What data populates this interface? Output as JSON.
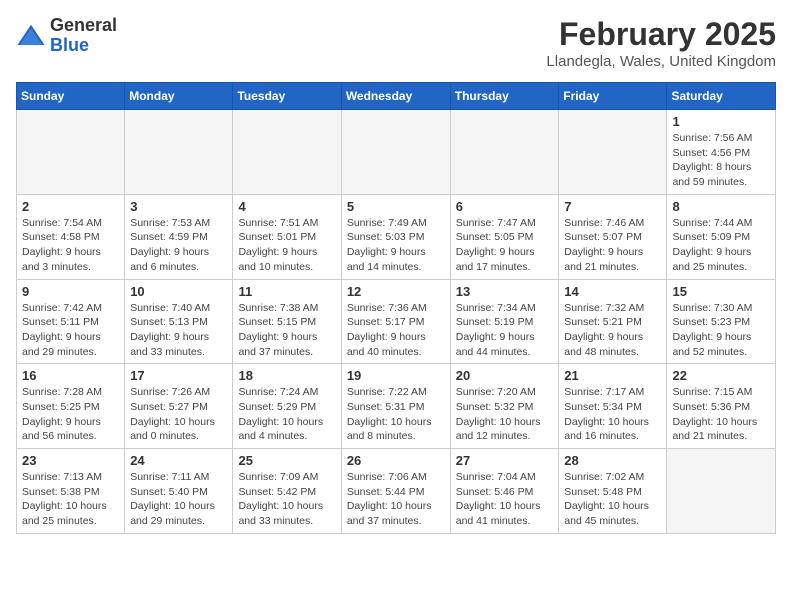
{
  "logo": {
    "general": "General",
    "blue": "Blue"
  },
  "title": "February 2025",
  "location": "Llandegla, Wales, United Kingdom",
  "days_of_week": [
    "Sunday",
    "Monday",
    "Tuesday",
    "Wednesday",
    "Thursday",
    "Friday",
    "Saturday"
  ],
  "weeks": [
    [
      {
        "day": "",
        "info": ""
      },
      {
        "day": "",
        "info": ""
      },
      {
        "day": "",
        "info": ""
      },
      {
        "day": "",
        "info": ""
      },
      {
        "day": "",
        "info": ""
      },
      {
        "day": "",
        "info": ""
      },
      {
        "day": "1",
        "info": "Sunrise: 7:56 AM\nSunset: 4:56 PM\nDaylight: 8 hours and 59 minutes."
      }
    ],
    [
      {
        "day": "2",
        "info": "Sunrise: 7:54 AM\nSunset: 4:58 PM\nDaylight: 9 hours and 3 minutes."
      },
      {
        "day": "3",
        "info": "Sunrise: 7:53 AM\nSunset: 4:59 PM\nDaylight: 9 hours and 6 minutes."
      },
      {
        "day": "4",
        "info": "Sunrise: 7:51 AM\nSunset: 5:01 PM\nDaylight: 9 hours and 10 minutes."
      },
      {
        "day": "5",
        "info": "Sunrise: 7:49 AM\nSunset: 5:03 PM\nDaylight: 9 hours and 14 minutes."
      },
      {
        "day": "6",
        "info": "Sunrise: 7:47 AM\nSunset: 5:05 PM\nDaylight: 9 hours and 17 minutes."
      },
      {
        "day": "7",
        "info": "Sunrise: 7:46 AM\nSunset: 5:07 PM\nDaylight: 9 hours and 21 minutes."
      },
      {
        "day": "8",
        "info": "Sunrise: 7:44 AM\nSunset: 5:09 PM\nDaylight: 9 hours and 25 minutes."
      }
    ],
    [
      {
        "day": "9",
        "info": "Sunrise: 7:42 AM\nSunset: 5:11 PM\nDaylight: 9 hours and 29 minutes."
      },
      {
        "day": "10",
        "info": "Sunrise: 7:40 AM\nSunset: 5:13 PM\nDaylight: 9 hours and 33 minutes."
      },
      {
        "day": "11",
        "info": "Sunrise: 7:38 AM\nSunset: 5:15 PM\nDaylight: 9 hours and 37 minutes."
      },
      {
        "day": "12",
        "info": "Sunrise: 7:36 AM\nSunset: 5:17 PM\nDaylight: 9 hours and 40 minutes."
      },
      {
        "day": "13",
        "info": "Sunrise: 7:34 AM\nSunset: 5:19 PM\nDaylight: 9 hours and 44 minutes."
      },
      {
        "day": "14",
        "info": "Sunrise: 7:32 AM\nSunset: 5:21 PM\nDaylight: 9 hours and 48 minutes."
      },
      {
        "day": "15",
        "info": "Sunrise: 7:30 AM\nSunset: 5:23 PM\nDaylight: 9 hours and 52 minutes."
      }
    ],
    [
      {
        "day": "16",
        "info": "Sunrise: 7:28 AM\nSunset: 5:25 PM\nDaylight: 9 hours and 56 minutes."
      },
      {
        "day": "17",
        "info": "Sunrise: 7:26 AM\nSunset: 5:27 PM\nDaylight: 10 hours and 0 minutes."
      },
      {
        "day": "18",
        "info": "Sunrise: 7:24 AM\nSunset: 5:29 PM\nDaylight: 10 hours and 4 minutes."
      },
      {
        "day": "19",
        "info": "Sunrise: 7:22 AM\nSunset: 5:31 PM\nDaylight: 10 hours and 8 minutes."
      },
      {
        "day": "20",
        "info": "Sunrise: 7:20 AM\nSunset: 5:32 PM\nDaylight: 10 hours and 12 minutes."
      },
      {
        "day": "21",
        "info": "Sunrise: 7:17 AM\nSunset: 5:34 PM\nDaylight: 10 hours and 16 minutes."
      },
      {
        "day": "22",
        "info": "Sunrise: 7:15 AM\nSunset: 5:36 PM\nDaylight: 10 hours and 21 minutes."
      }
    ],
    [
      {
        "day": "23",
        "info": "Sunrise: 7:13 AM\nSunset: 5:38 PM\nDaylight: 10 hours and 25 minutes."
      },
      {
        "day": "24",
        "info": "Sunrise: 7:11 AM\nSunset: 5:40 PM\nDaylight: 10 hours and 29 minutes."
      },
      {
        "day": "25",
        "info": "Sunrise: 7:09 AM\nSunset: 5:42 PM\nDaylight: 10 hours and 33 minutes."
      },
      {
        "day": "26",
        "info": "Sunrise: 7:06 AM\nSunset: 5:44 PM\nDaylight: 10 hours and 37 minutes."
      },
      {
        "day": "27",
        "info": "Sunrise: 7:04 AM\nSunset: 5:46 PM\nDaylight: 10 hours and 41 minutes."
      },
      {
        "day": "28",
        "info": "Sunrise: 7:02 AM\nSunset: 5:48 PM\nDaylight: 10 hours and 45 minutes."
      },
      {
        "day": "",
        "info": ""
      }
    ]
  ]
}
